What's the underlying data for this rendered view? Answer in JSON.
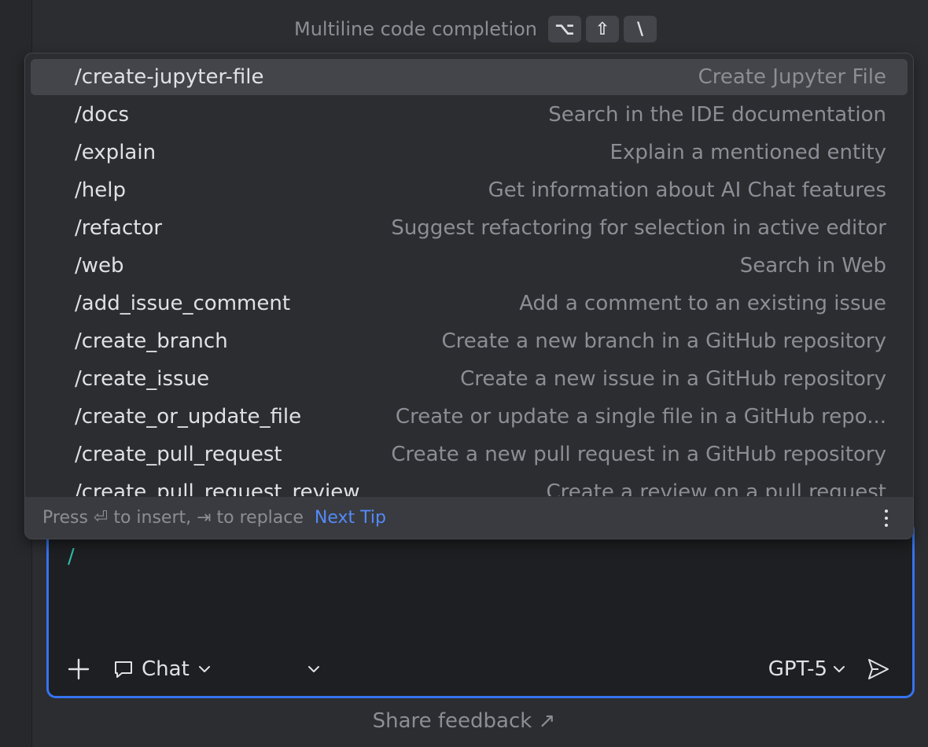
{
  "hint": {
    "text": "Multiline code completion",
    "keys": [
      "⌥",
      "⇧",
      "\\"
    ]
  },
  "commands": [
    {
      "cmd": "/create-jupyter-file",
      "desc": "Create Jupyter File",
      "selected": true
    },
    {
      "cmd": "/docs",
      "desc": "Search in the IDE documentation"
    },
    {
      "cmd": "/explain",
      "desc": "Explain a mentioned entity"
    },
    {
      "cmd": "/help",
      "desc": "Get information about AI Chat features"
    },
    {
      "cmd": "/refactor",
      "desc": "Suggest refactoring for selection in active editor"
    },
    {
      "cmd": "/web",
      "desc": "Search in Web"
    },
    {
      "cmd": "/add_issue_comment",
      "desc": "Add a comment to an existing issue"
    },
    {
      "cmd": "/create_branch",
      "desc": "Create a new branch in a GitHub repository"
    },
    {
      "cmd": "/create_issue",
      "desc": "Create a new issue in a GitHub repository"
    },
    {
      "cmd": "/create_or_update_file",
      "desc": "Create or update a single file in a GitHub repo..."
    },
    {
      "cmd": "/create_pull_request",
      "desc": "Create a new pull request in a GitHub repository"
    },
    {
      "cmd": "/create_pull_request_review",
      "desc": "Create a review on a pull request"
    }
  ],
  "popup_footer": {
    "hint": "Press ⏎ to insert, ⇥ to replace",
    "next_tip": "Next Tip"
  },
  "input": {
    "value": "/",
    "mode_label": "Chat",
    "model_label": "GPT-5"
  },
  "feedback_label": "Share feedback ↗",
  "colors": {
    "accent": "#3574f0",
    "link": "#548af7",
    "prompt": "#2fbdaa"
  }
}
